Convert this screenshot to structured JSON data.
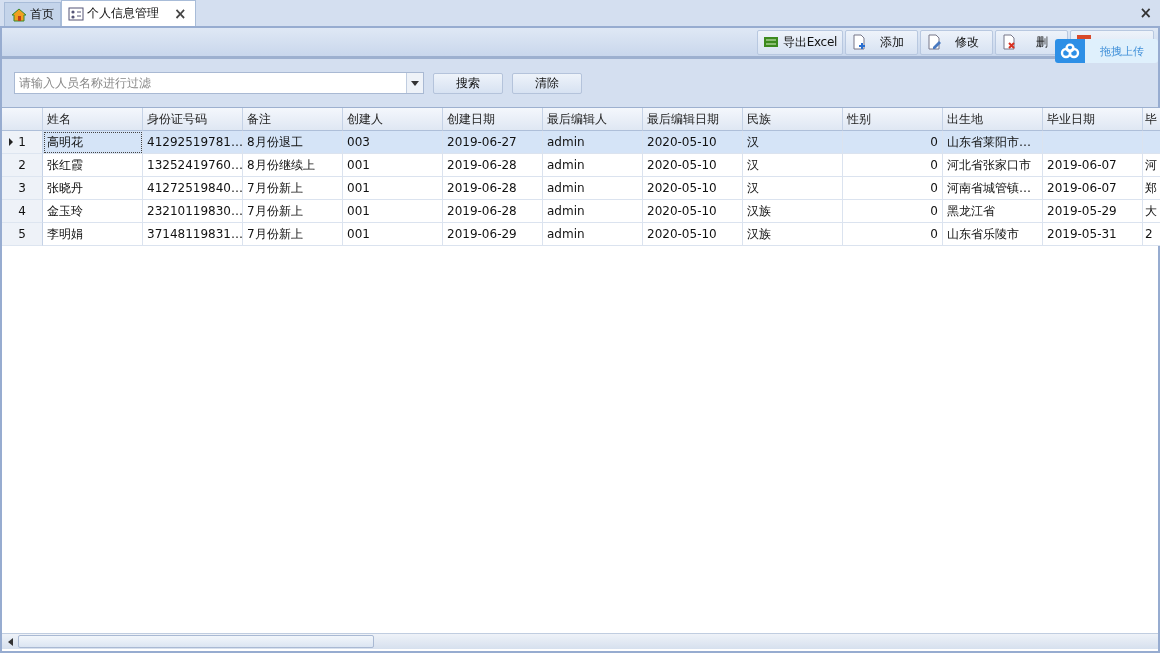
{
  "tabs": [
    {
      "label": "首页",
      "closable": false,
      "selected": false
    },
    {
      "label": "个人信息管理",
      "closable": true,
      "selected": true
    }
  ],
  "window_close": "×",
  "toolbar": [
    {
      "label": "导出Excel"
    },
    {
      "label": "添加"
    },
    {
      "label": "修改"
    },
    {
      "label": "删"
    }
  ],
  "upload_overlay": {
    "label": "拖拽上传"
  },
  "filter": {
    "placeholder": "请输入人员名称进行过滤",
    "buttons": [
      "搜索",
      "清除"
    ]
  },
  "table": {
    "columns": [
      {
        "label": "姓名",
        "kind": "text"
      },
      {
        "label": "身份证号码",
        "kind": "text"
      },
      {
        "label": "备注",
        "kind": "text"
      },
      {
        "label": "创建人",
        "kind": "text"
      },
      {
        "label": "创建日期",
        "kind": "text"
      },
      {
        "label": "最后编辑人",
        "kind": "text"
      },
      {
        "label": "最后编辑日期",
        "kind": "text"
      },
      {
        "label": "民族",
        "kind": "text"
      },
      {
        "label": "性别",
        "kind": "number"
      },
      {
        "label": "出生地",
        "kind": "text"
      },
      {
        "label": "毕业日期",
        "kind": "text"
      },
      {
        "label": "毕",
        "kind": "text"
      }
    ],
    "rows": [
      {
        "index": "1",
        "selected": true,
        "cells": [
          "高明花",
          "41292519781…",
          "8月份退工",
          "003",
          "2019-06-27",
          "admin",
          "2020-05-10",
          "汉",
          "0",
          "山东省莱阳市…",
          "",
          ""
        ]
      },
      {
        "index": "2",
        "selected": false,
        "cells": [
          "张红霞",
          "13252419760…",
          "8月份继续上",
          "001",
          "2019-06-28",
          "admin",
          "2020-05-10",
          "汉",
          "0",
          "河北省张家口市",
          "2019-06-07",
          "河"
        ]
      },
      {
        "index": "3",
        "selected": false,
        "cells": [
          "张晓丹",
          "41272519840…",
          "7月份新上",
          "001",
          "2019-06-28",
          "admin",
          "2020-05-10",
          "汉",
          "0",
          "河南省城管镇…",
          "2019-06-07",
          "郑"
        ]
      },
      {
        "index": "4",
        "selected": false,
        "cells": [
          "金玉玲",
          "23210119830…",
          "7月份新上",
          "001",
          "2019-06-28",
          "admin",
          "2020-05-10",
          "汉族",
          "0",
          "黑龙江省",
          "2019-05-29",
          "大"
        ]
      },
      {
        "index": "5",
        "selected": false,
        "cells": [
          "李明娟",
          "37148119831…",
          "7月份新上",
          "001",
          "2019-06-29",
          "admin",
          "2020-05-10",
          "汉族",
          "0",
          "山东省乐陵市",
          "2019-05-31",
          "2"
        ]
      }
    ]
  }
}
